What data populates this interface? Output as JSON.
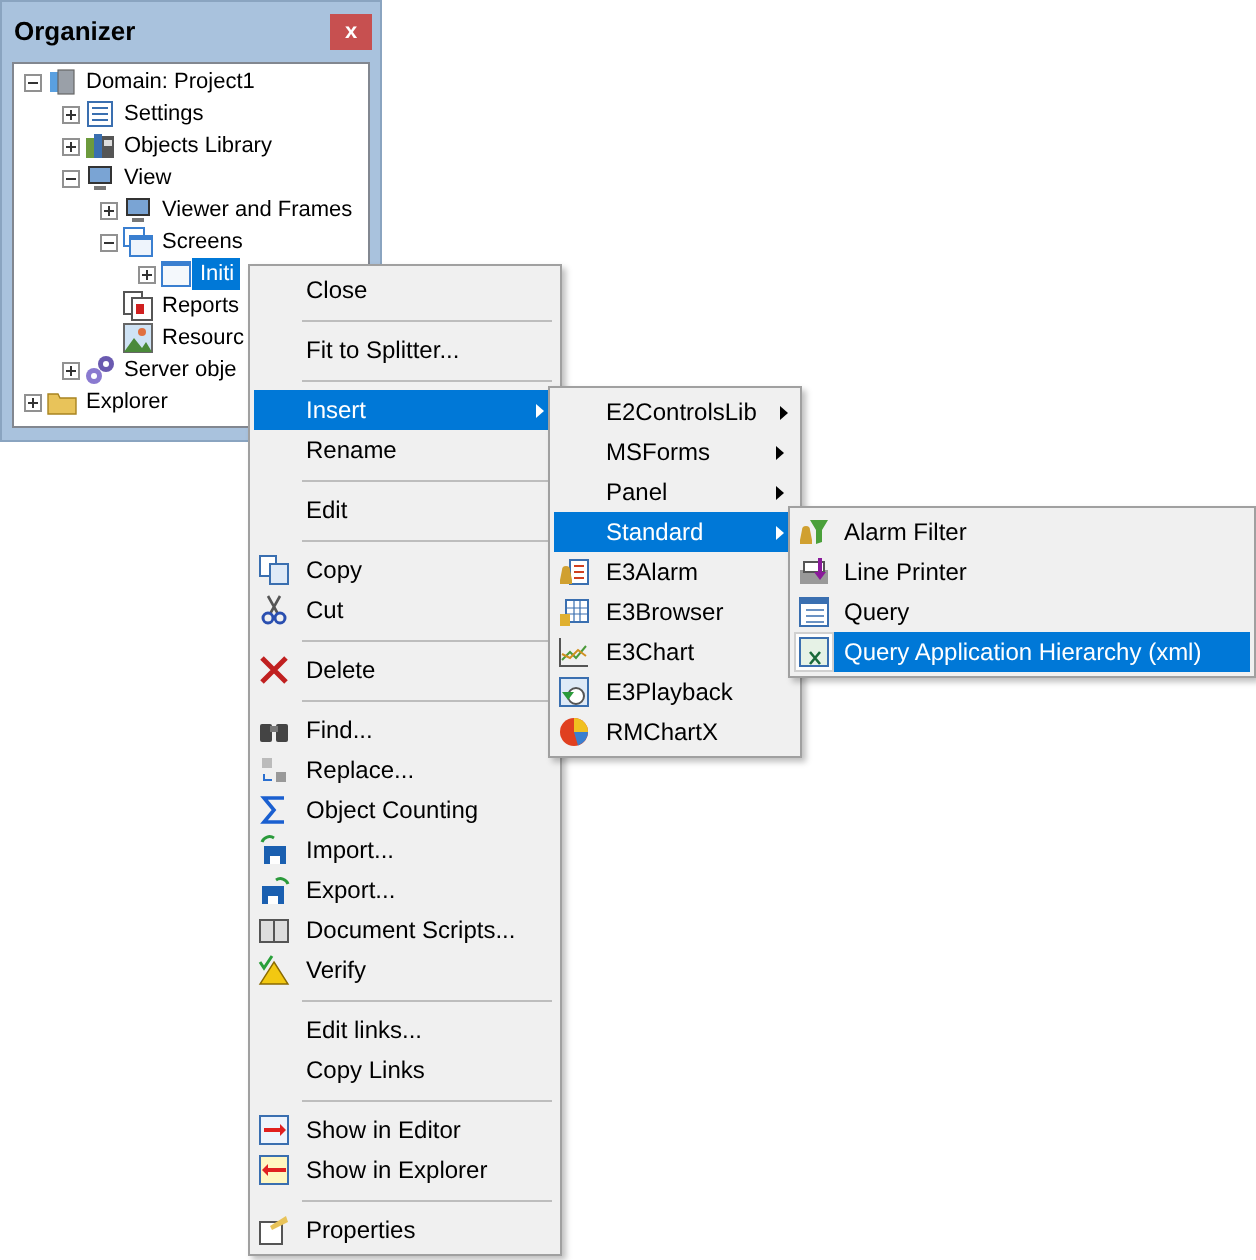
{
  "panel": {
    "title": "Organizer",
    "close_button": "x"
  },
  "tree": [
    {
      "label": "Domain: Project1",
      "kind": "node",
      "expanded": true,
      "selected": false,
      "children": [
        {
          "label": "Settings",
          "kind": "node",
          "expanded": false,
          "selected": false
        },
        {
          "label": "Objects Library",
          "kind": "node",
          "expanded": false,
          "selected": false
        },
        {
          "label": "View",
          "kind": "node",
          "expanded": true,
          "selected": false,
          "children": [
            {
              "label": "Viewer and Frames",
              "kind": "node",
              "expanded": false,
              "selected": false
            },
            {
              "label": "Screens",
              "kind": "node",
              "expanded": true,
              "selected": false,
              "children": [
                {
                  "label": "Initi",
                  "kind": "node",
                  "expanded": false,
                  "selected": true
                }
              ]
            },
            {
              "label": "Reports",
              "kind": "leaf",
              "selected": false
            },
            {
              "label": "Resourc",
              "kind": "leaf",
              "selected": false
            }
          ]
        },
        {
          "label": "Server obje",
          "kind": "node",
          "expanded": false,
          "selected": false
        }
      ]
    },
    {
      "label": "Explorer",
      "kind": "node",
      "expanded": false,
      "selected": false
    }
  ],
  "context_menu": {
    "items": [
      {
        "kind": "item",
        "label": "Close",
        "selected": false,
        "submenu": false
      },
      {
        "kind": "separator"
      },
      {
        "kind": "item",
        "label": "Fit to Splitter...",
        "selected": false,
        "submenu": false
      },
      {
        "kind": "separator"
      },
      {
        "kind": "item",
        "label": "Insert",
        "selected": true,
        "submenu": true
      },
      {
        "kind": "item",
        "label": "Rename",
        "selected": false,
        "submenu": false
      },
      {
        "kind": "separator"
      },
      {
        "kind": "item",
        "label": "Edit",
        "selected": false,
        "submenu": false
      },
      {
        "kind": "separator"
      },
      {
        "kind": "item",
        "label": "Copy",
        "selected": false,
        "submenu": false
      },
      {
        "kind": "item",
        "label": "Cut",
        "selected": false,
        "submenu": false
      },
      {
        "kind": "separator"
      },
      {
        "kind": "item",
        "label": "Delete",
        "selected": false,
        "submenu": false
      },
      {
        "kind": "separator"
      },
      {
        "kind": "item",
        "label": "Find...",
        "selected": false,
        "submenu": false
      },
      {
        "kind": "item",
        "label": "Replace...",
        "selected": false,
        "submenu": false
      },
      {
        "kind": "item",
        "label": "Object Counting",
        "selected": false,
        "submenu": false
      },
      {
        "kind": "item",
        "label": "Import...",
        "selected": false,
        "submenu": false
      },
      {
        "kind": "item",
        "label": "Export...",
        "selected": false,
        "submenu": false
      },
      {
        "kind": "item",
        "label": "Document Scripts...",
        "selected": false,
        "submenu": false
      },
      {
        "kind": "item",
        "label": "Verify",
        "selected": false,
        "submenu": false
      },
      {
        "kind": "separator"
      },
      {
        "kind": "item",
        "label": "Edit links...",
        "selected": false,
        "submenu": false
      },
      {
        "kind": "item",
        "label": "Copy Links",
        "selected": false,
        "submenu": false
      },
      {
        "kind": "separator"
      },
      {
        "kind": "item",
        "label": "Show in Editor",
        "selected": false,
        "submenu": false
      },
      {
        "kind": "item",
        "label": "Show in Explorer",
        "selected": false,
        "submenu": false
      },
      {
        "kind": "separator"
      },
      {
        "kind": "item",
        "label": "Properties",
        "selected": false,
        "submenu": false
      }
    ]
  },
  "insert_submenu": {
    "items": [
      {
        "kind": "item",
        "label": "E2ControlsLib",
        "selected": false,
        "submenu": true
      },
      {
        "kind": "item",
        "label": "MSForms",
        "selected": false,
        "submenu": true
      },
      {
        "kind": "item",
        "label": "Panel",
        "selected": false,
        "submenu": true
      },
      {
        "kind": "item",
        "label": "Standard",
        "selected": true,
        "submenu": true
      },
      {
        "kind": "item",
        "label": "E3Alarm",
        "selected": false,
        "submenu": false
      },
      {
        "kind": "item",
        "label": "E3Browser",
        "selected": false,
        "submenu": false
      },
      {
        "kind": "item",
        "label": "E3Chart",
        "selected": false,
        "submenu": false
      },
      {
        "kind": "item",
        "label": "E3Playback",
        "selected": false,
        "submenu": false
      },
      {
        "kind": "item",
        "label": "RMChartX",
        "selected": false,
        "submenu": false
      }
    ]
  },
  "standard_submenu": {
    "items": [
      {
        "kind": "item",
        "label": "Alarm Filter",
        "selected": false,
        "submenu": false
      },
      {
        "kind": "item",
        "label": "Line Printer",
        "selected": false,
        "submenu": false
      },
      {
        "kind": "item",
        "label": "Query",
        "selected": false,
        "submenu": false
      },
      {
        "kind": "item",
        "label": "Query Application Hierarchy (xml)",
        "selected": true,
        "submenu": false
      }
    ]
  }
}
